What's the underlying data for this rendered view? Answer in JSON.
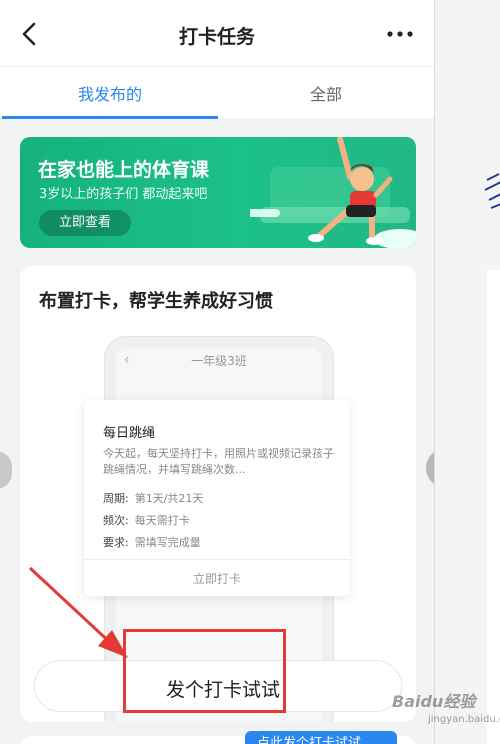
{
  "navbar": {
    "title": "打卡任务",
    "back_icon": "back-chevron-icon",
    "more_icon": "more-dots-icon"
  },
  "tabs": [
    {
      "label": "我发布的",
      "active": true
    },
    {
      "label": "全部",
      "active": false
    }
  ],
  "banner": {
    "title": "在家也能上的体育课",
    "subtitle": "3岁以上的孩子们 都动起来吧",
    "button": "立即查看"
  },
  "card": {
    "title": "布置打卡，帮学生养成好习惯",
    "mock_header": "一年级3班",
    "task": {
      "name": "每日跳绳",
      "description": "今天起，每天坚持打卡，用照片或视频记录孩子跳绳情况，并填写跳绳次数...",
      "rows": [
        {
          "key": "周期:",
          "value": "第1天/共21天"
        },
        {
          "key": "频次:",
          "value": "每天需打卡"
        },
        {
          "key": "要求:",
          "value": "需填写完成量"
        }
      ],
      "action": "立即打卡"
    },
    "cta": "发个打卡试试"
  },
  "bottom_tag": "点此发个打卡试试",
  "watermark": {
    "text": "Baidu经验",
    "sub": "jingyan.baidu.com"
  },
  "colors": {
    "accent": "#2b87ee",
    "banner": "#1cc08a",
    "annotation": "#e53935"
  }
}
